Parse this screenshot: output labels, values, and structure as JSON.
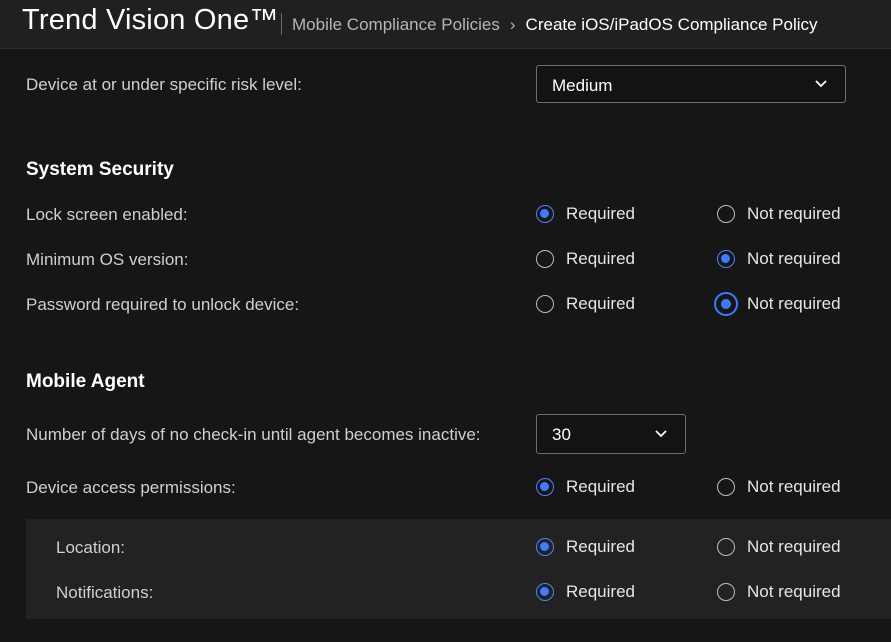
{
  "header": {
    "brand": "Trend Vision One™",
    "breadcrumb": [
      "Mobile Compliance Policies",
      "Create iOS/iPadOS Compliance Policy"
    ],
    "breadcrumb_separator": "›"
  },
  "risk": {
    "label": "Device at or under specific risk level:",
    "selected": "Medium"
  },
  "system_security": {
    "title": "System Security",
    "rows": [
      {
        "label": "Lock screen enabled:",
        "required": "Required",
        "not_required": "Not required",
        "value": "required"
      },
      {
        "label": "Minimum OS version:",
        "required": "Required",
        "not_required": "Not required",
        "value": "not_required"
      },
      {
        "label": "Password required to unlock device:",
        "required": "Required",
        "not_required": "Not required",
        "value": "not_required"
      }
    ]
  },
  "mobile_agent": {
    "title": "Mobile Agent",
    "inactive_days": {
      "label": "Number of days of no check-in until agent becomes inactive:",
      "selected": "30"
    },
    "access": {
      "label": "Device access permissions:",
      "required": "Required",
      "not_required": "Not required",
      "value": "required"
    },
    "permissions": [
      {
        "label": "Location:",
        "required": "Required",
        "not_required": "Not required",
        "value": "required"
      },
      {
        "label": "Notifications:",
        "required": "Required",
        "not_required": "Not required",
        "value": "required"
      }
    ]
  },
  "colors": {
    "accent": "#3f7bff",
    "background": "#161616",
    "subpanel": "#222222"
  },
  "icons": {
    "select_caret": "chevron-down-icon"
  }
}
